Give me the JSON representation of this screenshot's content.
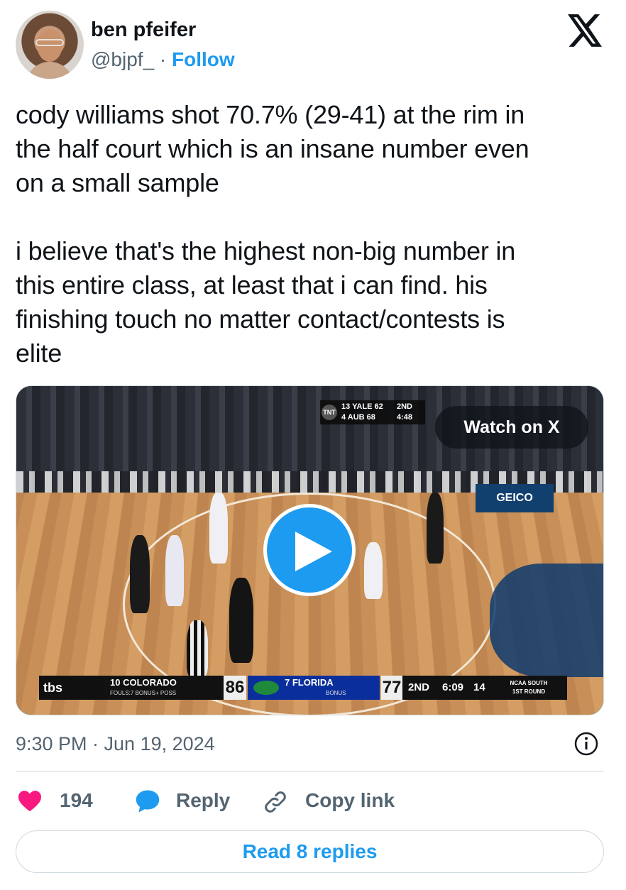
{
  "author": {
    "name": "ben pfeifer",
    "handle": "@bjpf_",
    "separator": "·",
    "follow_label": "Follow"
  },
  "tweet": {
    "text": "cody williams shot 70.7% (29-41) at the rim in\nthe half court which is an insane number even\non a small sample\n\ni believe that's the highest non-big number in\nthis entire class, at least that i can find. his\nfinishing touch no matter contact/contests is\nelite"
  },
  "media": {
    "watch_label": "Watch on X",
    "top_scoreboard": {
      "network": "TNT",
      "line1": "13 YALE 62",
      "line2": "4 AUB 68",
      "period": "2ND",
      "clock": "4:48"
    },
    "scorebar": {
      "network": "tbs",
      "team1": "10 COLORADO",
      "team1_sub": "FOULS:7   BONUS+   POSS",
      "score1": "86",
      "team2": "7 FLORIDA",
      "team2_sub": "BONUS",
      "score2": "77",
      "period": "2ND",
      "clock": "6:09",
      "shot_clock": "14",
      "region": "NCAA SOUTH",
      "round": "1ST ROUND"
    }
  },
  "meta": {
    "timestamp": "9:30 PM · Jun 19, 2024"
  },
  "actions": {
    "likes": "194",
    "reply_label": "Reply",
    "copy_label": "Copy link",
    "read_replies_label": "Read 8 replies"
  },
  "colors": {
    "accent": "#1d9bf0",
    "like": "#f91880",
    "muted": "#536471",
    "border": "#cfd9de"
  },
  "icons": [
    "x-logo-icon",
    "play-icon",
    "info-icon",
    "heart-icon",
    "reply-bubble-icon",
    "link-icon"
  ]
}
